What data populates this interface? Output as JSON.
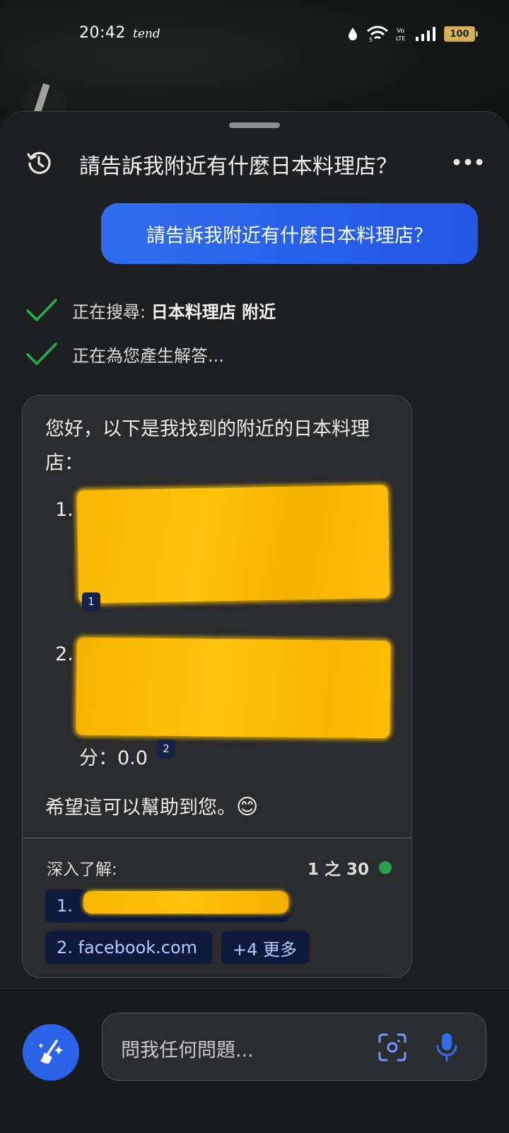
{
  "status_bar": {
    "time": "20:42",
    "carrier": "tend",
    "battery": "100",
    "network_badge": "Vo LTE"
  },
  "header": {
    "title": "請告訴我附近有什麼日本料理店？"
  },
  "user_message": "請告訴我附近有什麼日本料理店？",
  "steps": [
    {
      "prefix": "正在搜尋: ",
      "query": "日本料理店 附近"
    },
    {
      "text": "正在為您產生解答..."
    }
  ],
  "answer": {
    "intro": "您好，以下是我找到的附近的日本料理店：",
    "item1_number": "1.",
    "item2_number": "2.",
    "item2_visible_text": "分：0.0",
    "citations": [
      "1",
      "2"
    ],
    "closing": "希望這可以幫助到您。",
    "closing_emoji": "😊",
    "learn_more_label": "深入了解:",
    "page_counter": "1 之 30",
    "sources": [
      {
        "label": "1."
      },
      {
        "label": "2. facebook.com"
      }
    ],
    "more_label": "+4 更多"
  },
  "input": {
    "placeholder": "問我任何問題..."
  },
  "colors": {
    "accent_blue": "#2f6dee",
    "check_green": "#22b04a",
    "redaction_yellow": "#f7b900",
    "status_green": "#2aa14f"
  },
  "icons": [
    "history-icon",
    "more-icon",
    "check-icon",
    "new-topic-icon",
    "camera-icon",
    "mic-icon"
  ]
}
